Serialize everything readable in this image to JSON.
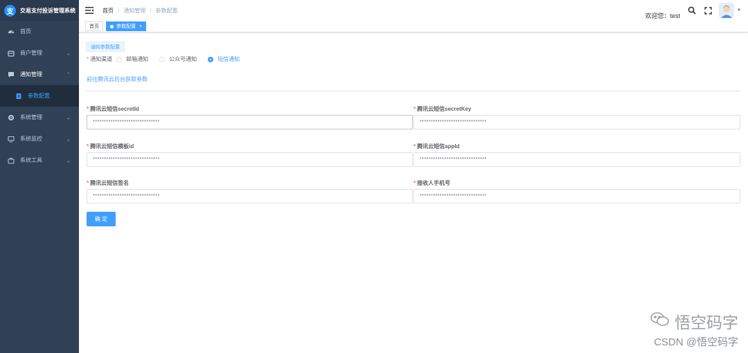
{
  "sidebar": {
    "brand": "交易支付投诉管理系统",
    "brand_logo": "支",
    "items": [
      {
        "label": "首页",
        "icon": "dashboard-icon"
      },
      {
        "label": "商户管理",
        "icon": "store-icon"
      },
      {
        "label": "通知管理",
        "icon": "message-icon"
      },
      {
        "label": "参数配置",
        "icon": "document-icon"
      },
      {
        "label": "系统管理",
        "icon": "gear-icon"
      },
      {
        "label": "系统监控",
        "icon": "monitor-icon"
      },
      {
        "label": "系统工具",
        "icon": "toolbox-icon"
      }
    ]
  },
  "header": {
    "breadcrumb": [
      "首页",
      "通知管理",
      "参数配置"
    ],
    "welcome": "欢迎您：test"
  },
  "tags": {
    "home": "首页",
    "active": "参数配置"
  },
  "form": {
    "section": "通知参数配置",
    "channel_label": "通知渠道",
    "channels": [
      "邮箱通知",
      "公众号通知",
      "短信通知"
    ],
    "selected_channel": "短信通知",
    "link": "前往腾讯云后台获取参数",
    "fields": [
      {
        "label": "腾讯云短信secretId",
        "value": "******************************"
      },
      {
        "label": "腾讯云短信secretKey",
        "value": "******************************"
      },
      {
        "label": "腾讯云短信模板id",
        "value": "******************************"
      },
      {
        "label": "腾讯云短信appId",
        "value": "******************************"
      },
      {
        "label": "腾讯云短信签名",
        "value": "******************************"
      },
      {
        "label": "接收人手机号",
        "value": "******************************"
      }
    ],
    "submit": "确 定"
  },
  "watermark": {
    "brand": "悟空码字",
    "footer": "CSDN @悟空码字"
  },
  "colors": {
    "sidebar_bg": "#304156",
    "accent": "#409eff",
    "required": "#f56c6c"
  }
}
